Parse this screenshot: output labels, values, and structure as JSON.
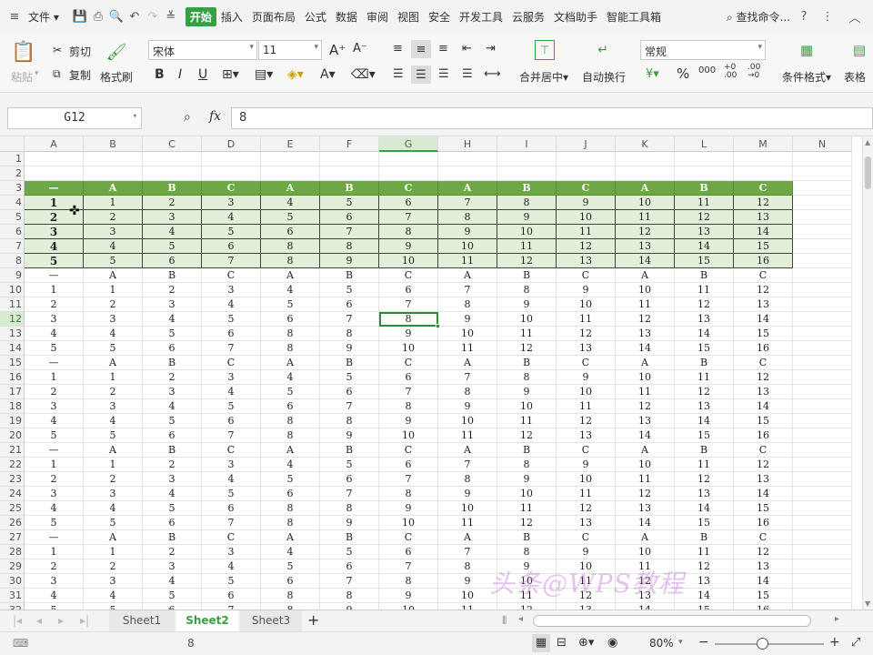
{
  "menubar": {
    "file_label": "文件",
    "tabs": [
      "开始",
      "插入",
      "页面布局",
      "公式",
      "数据",
      "审阅",
      "视图",
      "安全",
      "开发工具",
      "云服务",
      "文档助手",
      "智能工具箱"
    ],
    "active_tab": "开始",
    "search_label": "查找命令...",
    "help": "?"
  },
  "ribbon": {
    "paste": "粘贴",
    "cut": "剪切",
    "copy": "复制",
    "format_painter": "格式刷",
    "font_name": "宋体",
    "font_size": "11",
    "merge_center": "合并居中",
    "wrap_text": "自动换行",
    "number_format": "常规",
    "conditional_format": "条件格式",
    "table_style": "表格"
  },
  "formula_bar": {
    "name_box": "G12",
    "fx": "fx",
    "content": "8"
  },
  "grid": {
    "columns": [
      "A",
      "B",
      "C",
      "D",
      "E",
      "F",
      "G",
      "H",
      "I",
      "J",
      "K",
      "L",
      "M",
      "N"
    ],
    "row_numbers": [
      "1",
      "2",
      "3",
      "4",
      "5",
      "6",
      "7",
      "8",
      "9",
      "10",
      "11",
      "12",
      "13",
      "14",
      "15",
      "16",
      "17",
      "18",
      "19",
      "20",
      "21",
      "22",
      "23",
      "24",
      "25",
      "26",
      "27",
      "28",
      "29",
      "30",
      "31",
      "32"
    ],
    "table_header": [
      "—",
      "A",
      "B",
      "C",
      "A",
      "B",
      "C",
      "A",
      "B",
      "C",
      "A",
      "B",
      "C"
    ],
    "table_rows": [
      [
        "1",
        "1",
        "2",
        "3",
        "4",
        "5",
        "6",
        "7",
        "8",
        "9",
        "10",
        "11",
        "12"
      ],
      [
        "2",
        "2",
        "3",
        "4",
        "5",
        "6",
        "7",
        "8",
        "9",
        "10",
        "11",
        "12",
        "13"
      ],
      [
        "3",
        "3",
        "4",
        "5",
        "6",
        "7",
        "8",
        "9",
        "10",
        "11",
        "12",
        "13",
        "14"
      ],
      [
        "4",
        "4",
        "5",
        "6",
        "8",
        "8",
        "9",
        "10",
        "11",
        "12",
        "13",
        "14",
        "15"
      ],
      [
        "5",
        "5",
        "6",
        "7",
        "8",
        "9",
        "10",
        "11",
        "12",
        "13",
        "14",
        "15",
        "16"
      ]
    ],
    "selected_cell": "G12"
  },
  "sheets": {
    "tabs": [
      "Sheet1",
      "Sheet2",
      "Sheet3"
    ],
    "active": "Sheet2",
    "add": "+"
  },
  "status": {
    "value": "8",
    "zoom": "80%"
  },
  "watermark": "头条@WPS教程",
  "colors": {
    "accent": "#3c9e43",
    "header_fill": "#6ea845",
    "row_fill": "#e2efd9"
  }
}
